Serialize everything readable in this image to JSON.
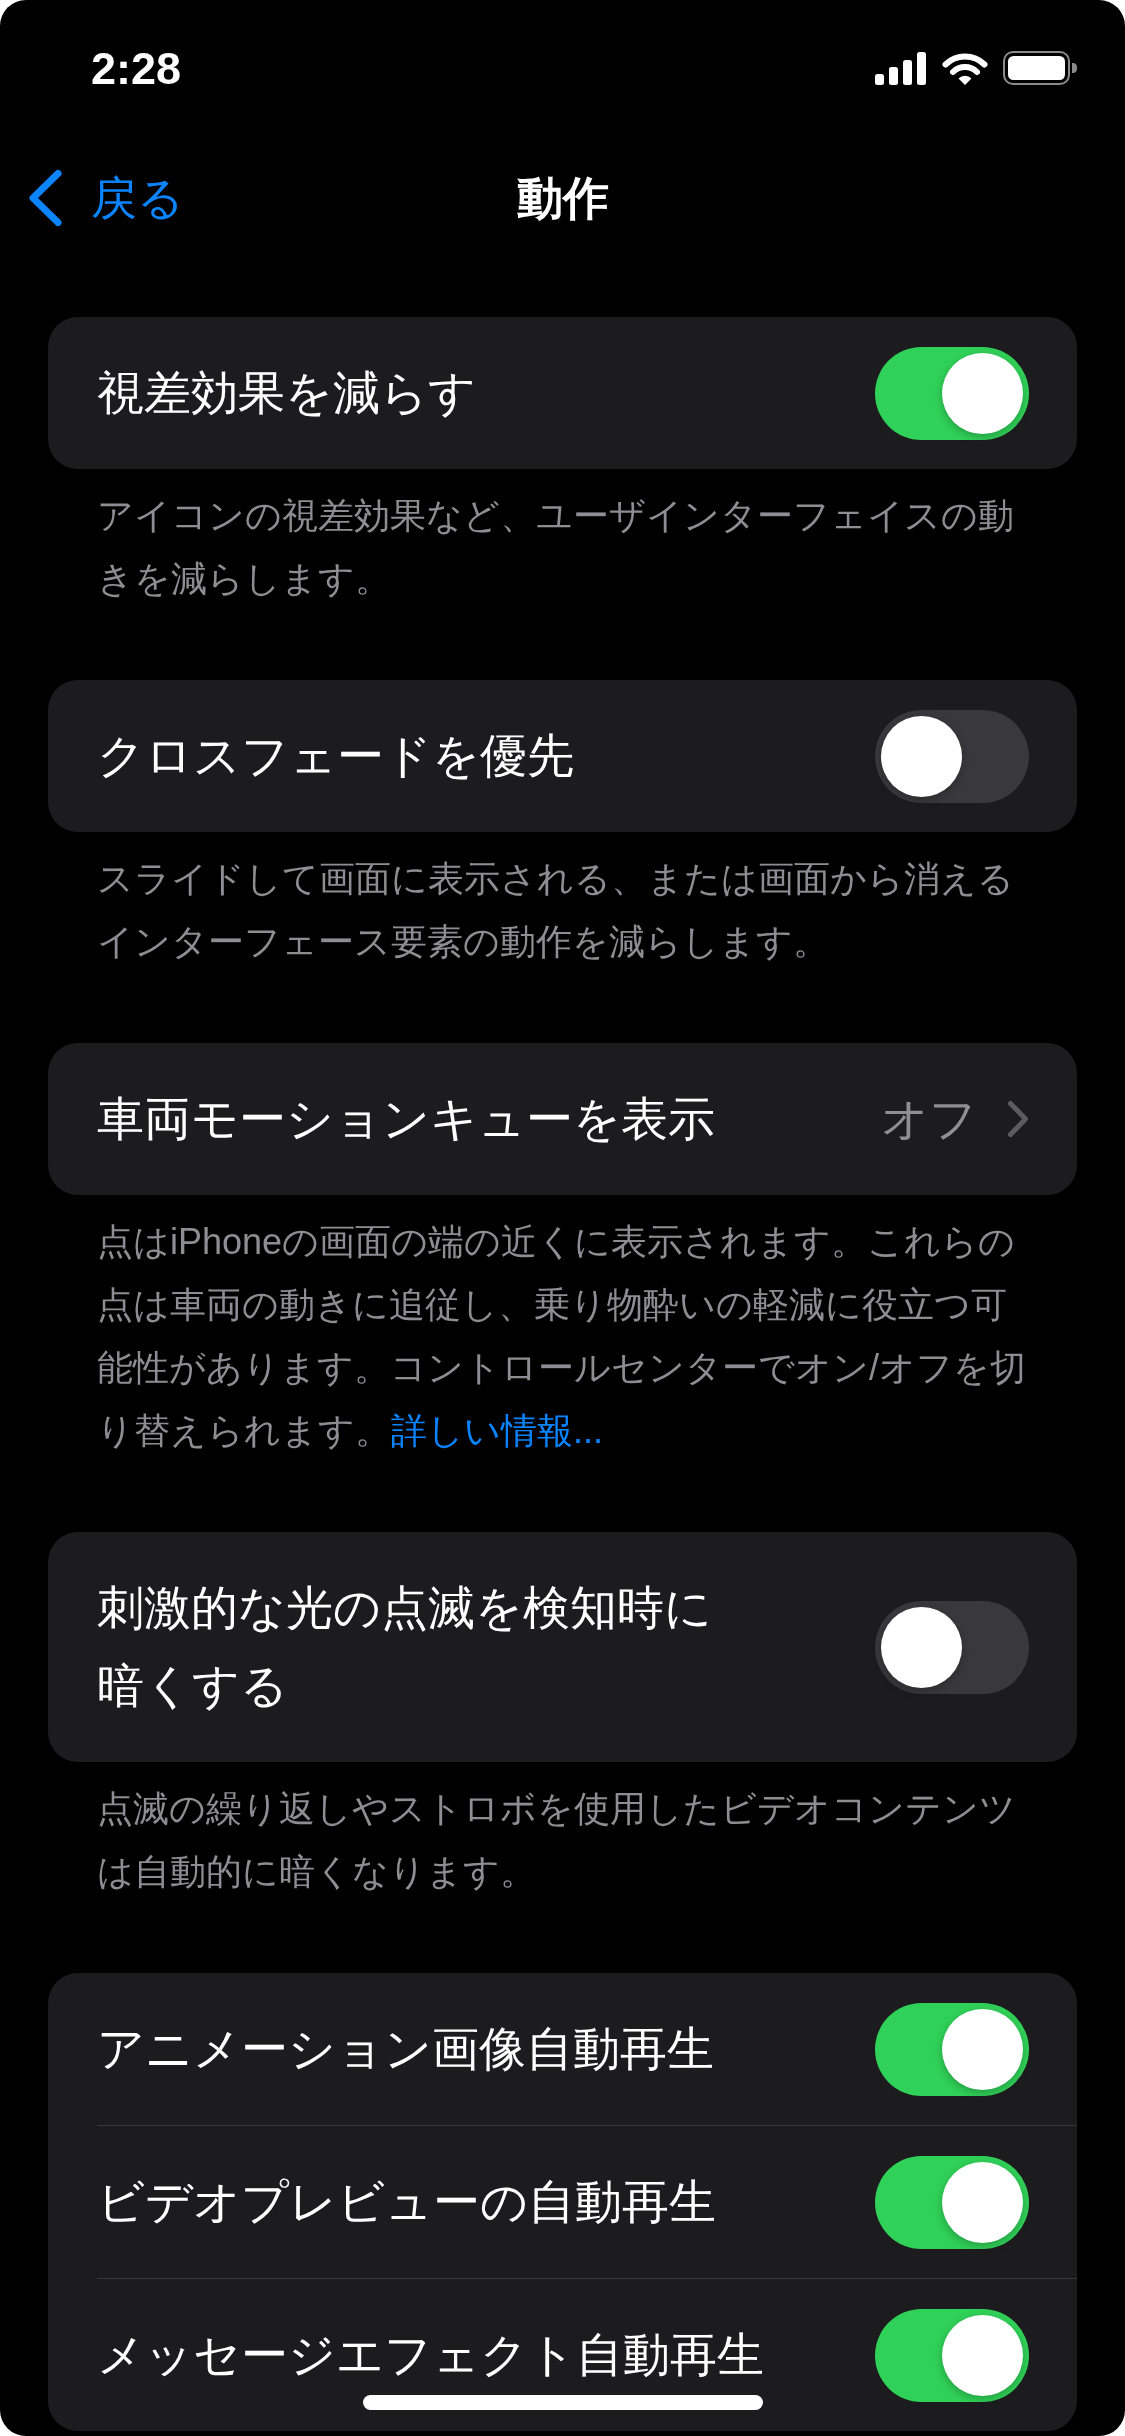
{
  "status_bar": {
    "time": "2:28"
  },
  "nav_bar": {
    "back_label": "戻る",
    "title": "動作"
  },
  "groups": [
    {
      "rows": [
        {
          "kind": "toggle",
          "label": "視差効果を減らす",
          "on": true
        }
      ],
      "footer": "アイコンの視差効果など、ユーザインターフェイスの動きを減らします。"
    },
    {
      "rows": [
        {
          "kind": "toggle",
          "label": "クロスフェードを優先",
          "on": false
        }
      ],
      "footer": "スライドして画面に表示される、または画面から消えるインターフェース要素の動作を減らします。"
    },
    {
      "rows": [
        {
          "kind": "disclosure",
          "label": "車両モーションキューを表示",
          "value": "オフ"
        }
      ],
      "footer": "点はiPhoneの画面の端の近くに表示されます。これらの点は車両の動きに追従し、乗り物酔いの軽減に役立つ可能性があります。コントロールセンターでオン/オフを切り替えられます。",
      "footer_link": "詳しい情報..."
    },
    {
      "rows": [
        {
          "kind": "toggle",
          "label": "刺激的な光の点滅を検知時に暗くする",
          "on": false
        }
      ],
      "footer": "点滅の繰り返しやストロボを使用したビデオコンテンツは自動的に暗くなります。"
    },
    {
      "rows": [
        {
          "kind": "toggle",
          "label": "アニメーション画像自動再生",
          "on": true
        },
        {
          "kind": "toggle",
          "label": "ビデオプレビューの自動再生",
          "on": true
        },
        {
          "kind": "toggle",
          "label": "メッセージエフェクト自動再生",
          "on": true
        }
      ]
    }
  ]
}
